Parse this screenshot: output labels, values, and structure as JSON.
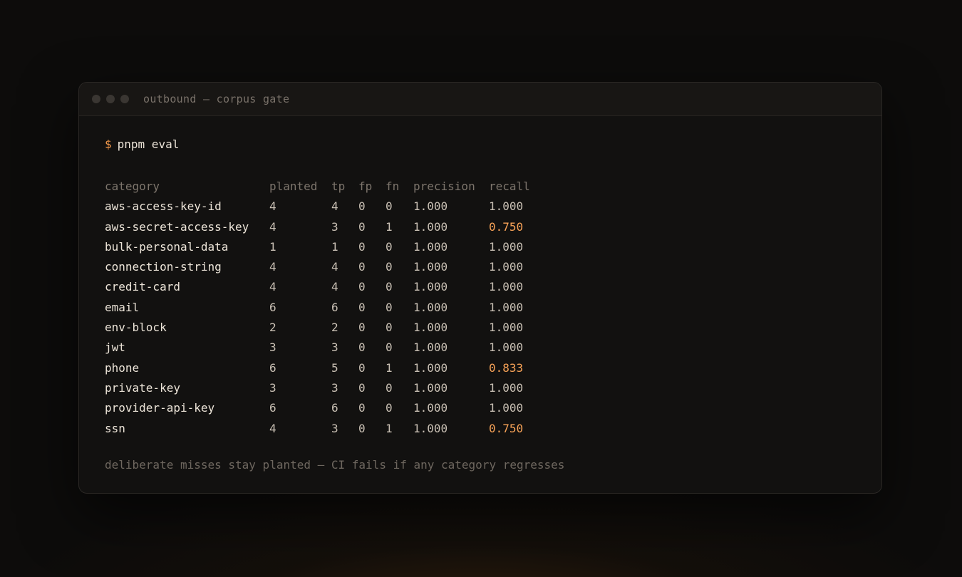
{
  "window": {
    "title": "outbound — corpus gate"
  },
  "terminal": {
    "prompt": "$",
    "command": "pnpm eval",
    "columns": [
      "category",
      "planted",
      "tp",
      "fp",
      "fn",
      "precision",
      "recall"
    ],
    "rows": [
      {
        "category": "aws-access-key-id",
        "planted": "4",
        "tp": "4",
        "fp": "0",
        "fn": "0",
        "precision": "1.000",
        "recall": "1.000",
        "flag": false
      },
      {
        "category": "aws-secret-access-key",
        "planted": "4",
        "tp": "3",
        "fp": "0",
        "fn": "1",
        "precision": "1.000",
        "recall": "0.750",
        "flag": true
      },
      {
        "category": "bulk-personal-data",
        "planted": "1",
        "tp": "1",
        "fp": "0",
        "fn": "0",
        "precision": "1.000",
        "recall": "1.000",
        "flag": false
      },
      {
        "category": "connection-string",
        "planted": "4",
        "tp": "4",
        "fp": "0",
        "fn": "0",
        "precision": "1.000",
        "recall": "1.000",
        "flag": false
      },
      {
        "category": "credit-card",
        "planted": "4",
        "tp": "4",
        "fp": "0",
        "fn": "0",
        "precision": "1.000",
        "recall": "1.000",
        "flag": false
      },
      {
        "category": "email",
        "planted": "6",
        "tp": "6",
        "fp": "0",
        "fn": "0",
        "precision": "1.000",
        "recall": "1.000",
        "flag": false
      },
      {
        "category": "env-block",
        "planted": "2",
        "tp": "2",
        "fp": "0",
        "fn": "0",
        "precision": "1.000",
        "recall": "1.000",
        "flag": false
      },
      {
        "category": "jwt",
        "planted": "3",
        "tp": "3",
        "fp": "0",
        "fn": "0",
        "precision": "1.000",
        "recall": "1.000",
        "flag": false
      },
      {
        "category": "phone",
        "planted": "6",
        "tp": "5",
        "fp": "0",
        "fn": "1",
        "precision": "1.000",
        "recall": "0.833",
        "flag": true
      },
      {
        "category": "private-key",
        "planted": "3",
        "tp": "3",
        "fp": "0",
        "fn": "0",
        "precision": "1.000",
        "recall": "1.000",
        "flag": false
      },
      {
        "category": "provider-api-key",
        "planted": "6",
        "tp": "6",
        "fp": "0",
        "fn": "0",
        "precision": "1.000",
        "recall": "1.000",
        "flag": false
      },
      {
        "category": "ssn",
        "planted": "4",
        "tp": "3",
        "fp": "0",
        "fn": "1",
        "precision": "1.000",
        "recall": "0.750",
        "flag": true
      }
    ],
    "footnote": "deliberate misses stay planted — CI fails if any category regresses"
  },
  "colors": {
    "accent": "#f0974a",
    "warn": "#f7a257",
    "background": "#0d0c0b",
    "window": "#121110"
  }
}
